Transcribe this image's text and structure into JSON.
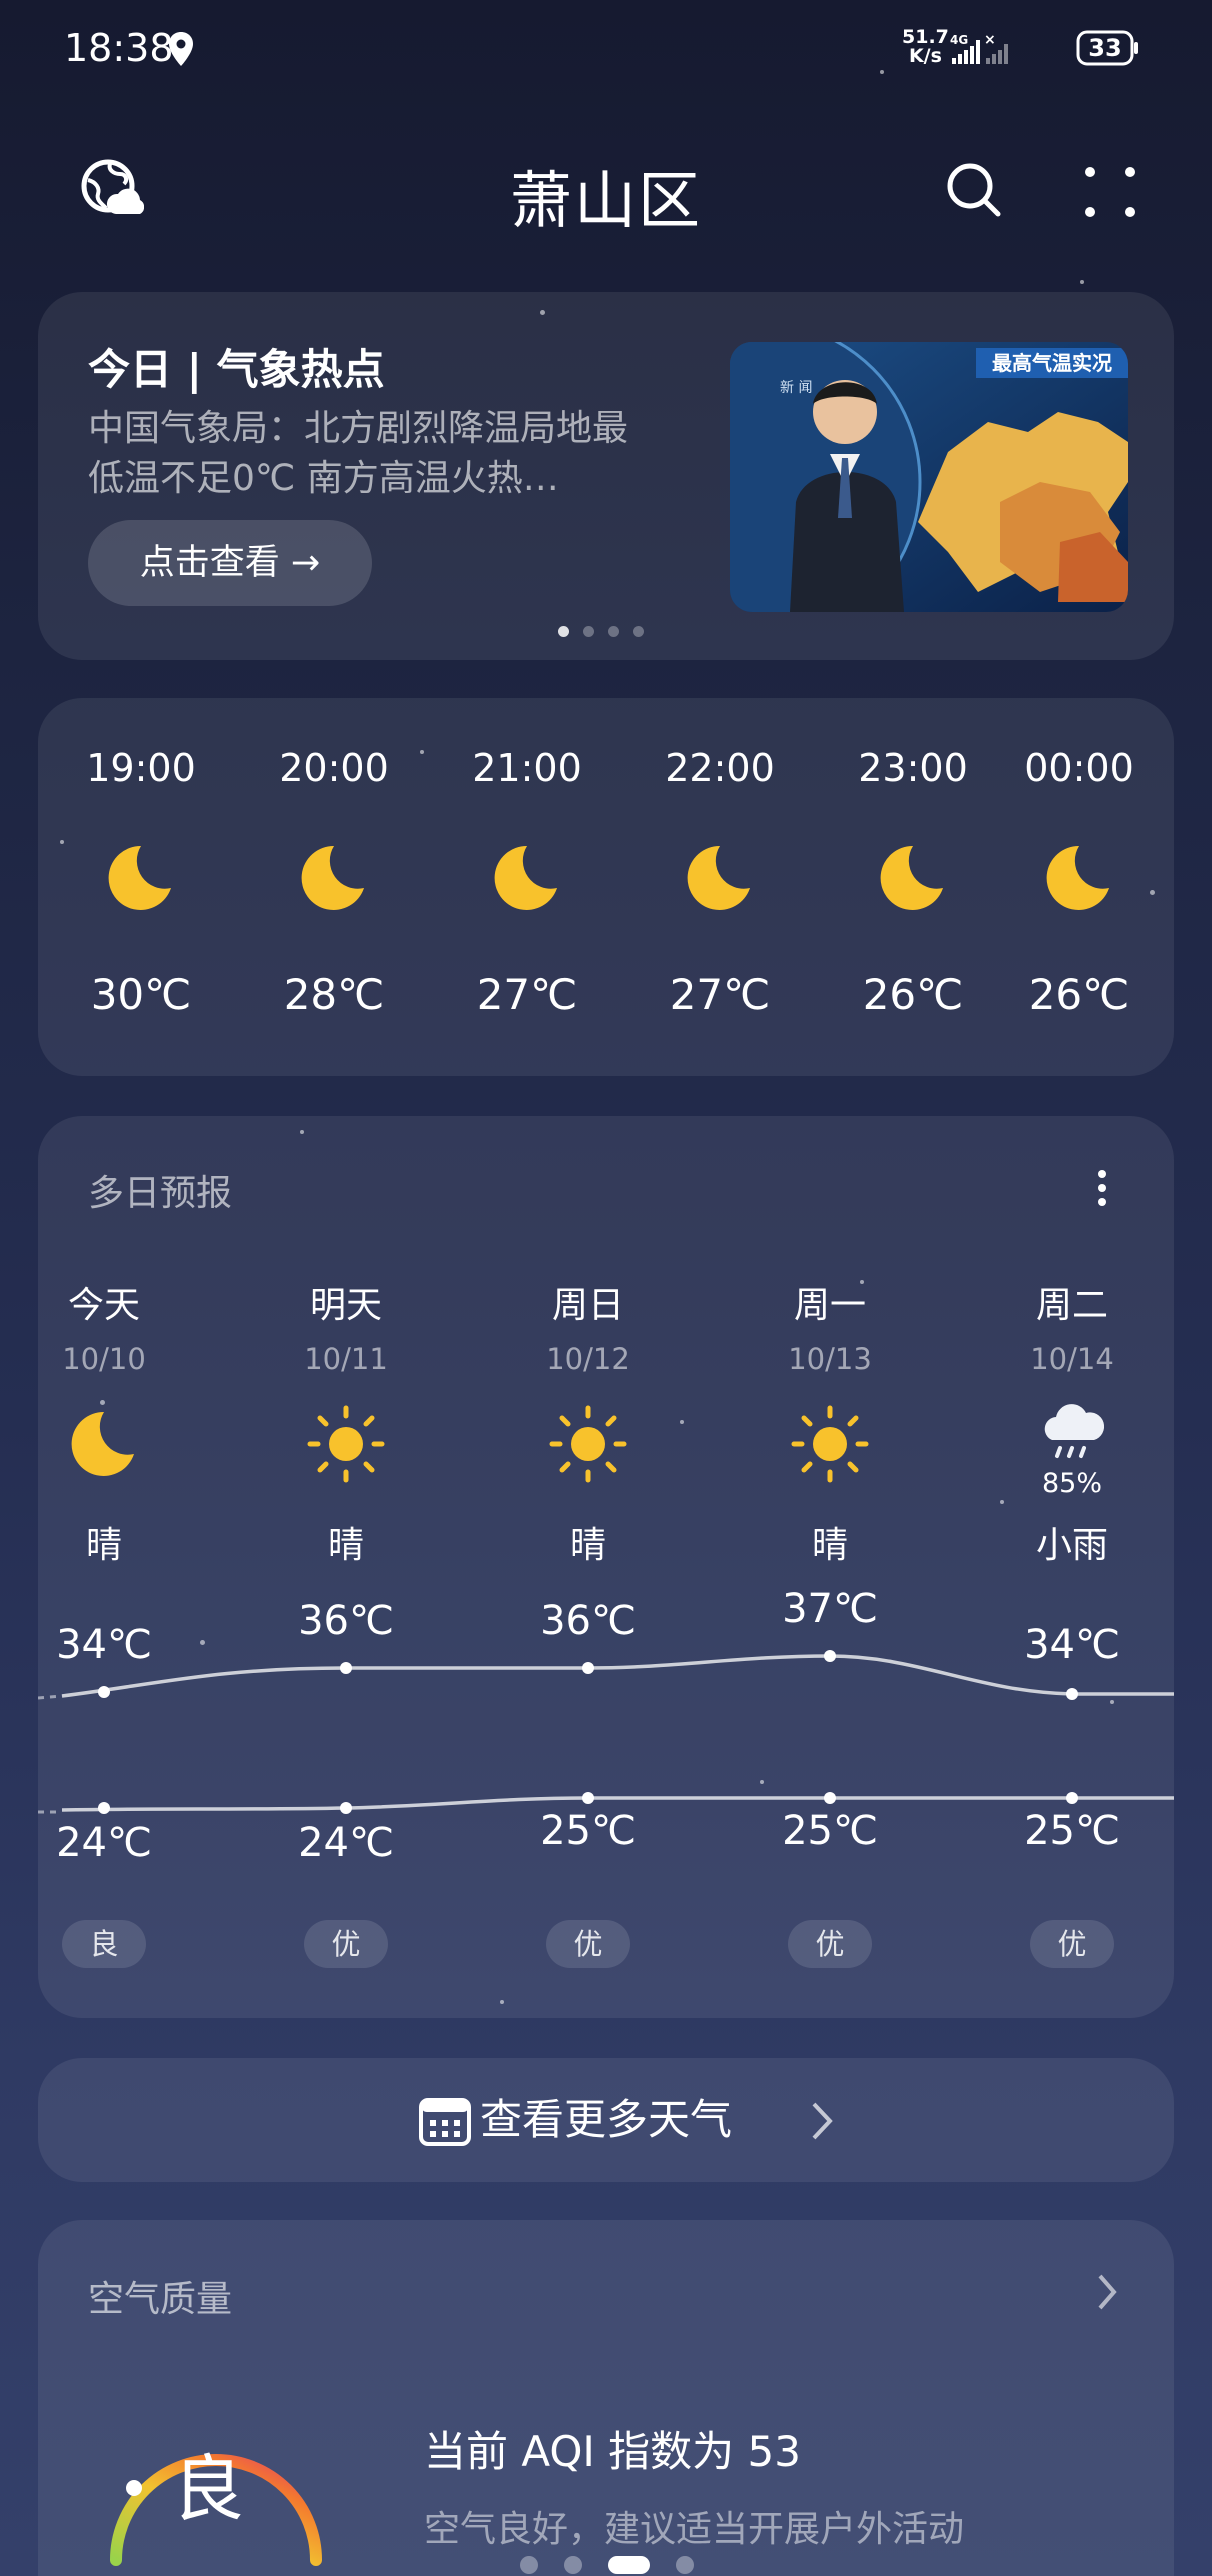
{
  "status": {
    "time": "18:38",
    "net_speed": "51.7",
    "net_unit": "K/s",
    "battery": "33"
  },
  "header": {
    "title": "萧山区"
  },
  "news": {
    "title": "今日 | 气象热点",
    "desc": "中国气象局：北方剧烈降温局地最低温不足0℃ 南方高温火热…",
    "button": "点击查看 →",
    "thumb_caption": "最高气温实况",
    "thumb_logo": "新 闻"
  },
  "hourly": [
    {
      "time": "19:00",
      "temp": "30℃",
      "icon": "moon-icon"
    },
    {
      "time": "20:00",
      "temp": "28℃",
      "icon": "moon-icon"
    },
    {
      "time": "21:00",
      "temp": "27℃",
      "icon": "moon-icon"
    },
    {
      "time": "22:00",
      "temp": "27℃",
      "icon": "moon-icon"
    },
    {
      "time": "23:00",
      "temp": "26℃",
      "icon": "moon-icon"
    },
    {
      "time": "00:00",
      "temp": "26℃",
      "icon": "moon-icon"
    }
  ],
  "multiday": {
    "title": "多日预报",
    "days": [
      {
        "name": "今天",
        "date": "10/10",
        "icon": "moon-icon",
        "cond": "晴",
        "high": "34℃",
        "low": "24℃",
        "aqi": "良"
      },
      {
        "name": "明天",
        "date": "10/11",
        "icon": "sun-icon",
        "cond": "晴",
        "high": "36℃",
        "low": "24℃",
        "aqi": "优"
      },
      {
        "name": "周日",
        "date": "10/12",
        "icon": "sun-icon",
        "cond": "晴",
        "high": "36℃",
        "low": "25℃",
        "aqi": "优"
      },
      {
        "name": "周一",
        "date": "10/13",
        "icon": "sun-icon",
        "cond": "晴",
        "high": "37℃",
        "low": "25℃",
        "aqi": "优"
      },
      {
        "name": "周二",
        "date": "10/14",
        "icon": "rain-cloud-icon",
        "precip": "85%",
        "cond": "小雨",
        "high": "34℃",
        "low": "25℃",
        "aqi": "优"
      }
    ]
  },
  "more_weather": {
    "label": "查看更多天气"
  },
  "air_quality": {
    "title": "空气质量",
    "level": "良",
    "text": "当前 AQI 指数为 53",
    "sub": "空气良好，建议适当开展户外活动"
  },
  "colors": {
    "accent_sun": "#f8c22c",
    "card": "rgba(255,255,255,0.08)"
  }
}
